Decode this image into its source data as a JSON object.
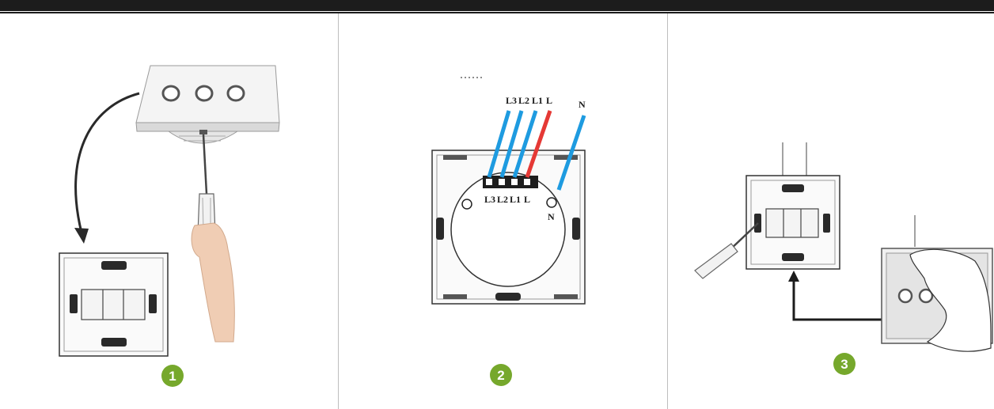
{
  "colors": {
    "header_bar": "#1c1c1c",
    "wire_live": "#e53935",
    "wire_switched": "#1e9be0",
    "step_badge": "#76a82c"
  },
  "panels": [
    {
      "step": "1"
    },
    {
      "step": "2",
      "wire_labels_top": [
        "L3",
        "L2",
        "L1",
        "L",
        "N"
      ],
      "terminal_labels": [
        "L3",
        "L2",
        "L1",
        "L"
      ],
      "neutral_label": "N"
    },
    {
      "step": "3"
    }
  ]
}
